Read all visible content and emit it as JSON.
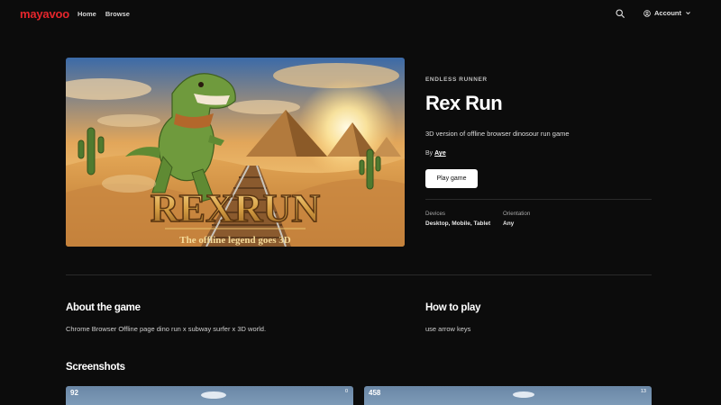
{
  "header": {
    "logo": "mayavoo",
    "nav": [
      "Home",
      "Browse"
    ],
    "account_label": "Account",
    "icons": [
      "search-icon",
      "user-circle-icon",
      "chevron-down-icon"
    ]
  },
  "hero": {
    "logo_text": "REXRUN",
    "tagline": "The offline legend goes 3D"
  },
  "game": {
    "genre": "ENDLESS RUNNER",
    "title": "Rex Run",
    "description": "3D version of offline browser dinosour run game",
    "by_prefix": "By",
    "author": "Aye",
    "play_label": "Play game",
    "devices_label": "Devices",
    "devices_value": "Desktop, Mobile, Tablet",
    "orientation_label": "Orientation",
    "orientation_value": "Any"
  },
  "about": {
    "heading": "About the game",
    "text": "Chrome Browser Offline page dino run x subway surfer x 3D world."
  },
  "howto": {
    "heading": "How to play",
    "text": "use arrow keys"
  },
  "screenshots": {
    "heading": "Screenshots",
    "items": [
      {
        "score": "92",
        "hud": "0"
      },
      {
        "score": "458",
        "hud": "13"
      }
    ]
  },
  "colors": {
    "brand": "#e5262c",
    "background": "#0c0c0c"
  }
}
